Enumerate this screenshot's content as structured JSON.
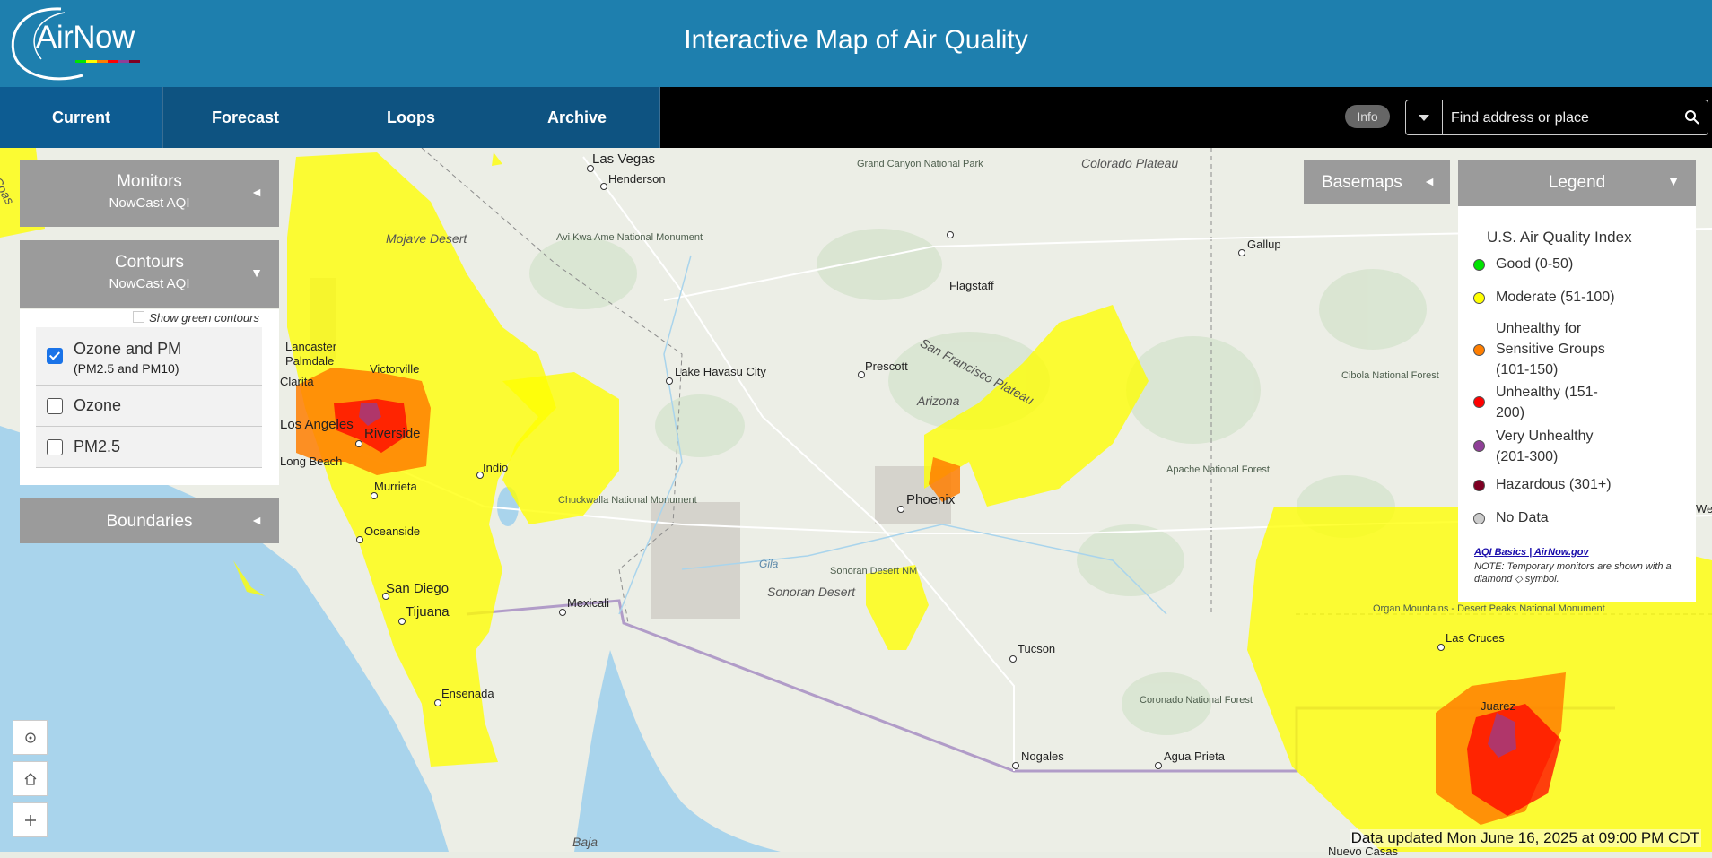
{
  "header": {
    "logo_text": "AirNow",
    "title": "Interactive Map of Air Quality"
  },
  "nav": {
    "tabs": [
      {
        "label": "Current",
        "active": true
      },
      {
        "label": "Forecast",
        "active": false
      },
      {
        "label": "Loops",
        "active": false
      },
      {
        "label": "Archive",
        "active": false
      }
    ],
    "info_label": "Info",
    "search_placeholder": "Find address or place"
  },
  "panels": {
    "monitors": {
      "title": "Monitors",
      "subtitle": "NowCast AQI",
      "arrow": "◄"
    },
    "contours": {
      "title": "Contours",
      "subtitle": "NowCast AQI",
      "arrow": "▼",
      "show_green_label": "Show green contours",
      "show_green_checked": false,
      "options": [
        {
          "label": "Ozone and PM",
          "sub": "(PM2.5 and PM10)",
          "checked": true
        },
        {
          "label": "Ozone",
          "sub": "",
          "checked": false
        },
        {
          "label": "PM2.5",
          "sub": "",
          "checked": false
        }
      ]
    },
    "boundaries": {
      "title": "Boundaries",
      "arrow": "◄"
    },
    "basemaps": {
      "title": "Basemaps",
      "arrow": "◄"
    },
    "legend": {
      "title": "Legend",
      "arrow": "▼",
      "heading": "U.S. Air Quality Index",
      "items": [
        {
          "label": "Good (0-50)",
          "color": "#00e400"
        },
        {
          "label": "Moderate (51-100)",
          "color": "#ffff00"
        },
        {
          "label": "Unhealthy for Sensitive Groups (101-150)",
          "color": "#ff7e00"
        },
        {
          "label": "Unhealthy (151-200)",
          "color": "#ff0000"
        },
        {
          "label": "Very Unhealthy (201-300)",
          "color": "#8f3f97"
        },
        {
          "label": "Hazardous (301+)",
          "color": "#7e0023"
        },
        {
          "label": "No Data",
          "color": "#cccccc"
        }
      ],
      "link_text": "AQI Basics | AirNow.gov",
      "note": "NOTE: Temporary monitors are shown with a diamond ◇ symbol."
    }
  },
  "map": {
    "places": [
      "Las Vegas",
      "Henderson",
      "Grand Canyon National Park",
      "Colorado Plateau",
      "Gallup",
      "Avi Kwa Ame National Monument",
      "Mojave Desert",
      "Flagstaff",
      "San Francisco Plateau",
      "Lancaster",
      "Palmdale",
      "Victorville",
      "Clarita",
      "Lake Havasu City",
      "Prescott",
      "Los Angeles",
      "Riverside",
      "Long Beach",
      "Arizona",
      "Cibola National Forest",
      "Indio",
      "Murrieta",
      "Chuckwalla National Monument",
      "Phoenix",
      "Apache National Forest",
      "Oceanside",
      "San Diego",
      "Tijuana",
      "Mexicali",
      "Gila",
      "Sonoran Desert NM",
      "Sonoran Desert",
      "Tucson",
      "Organ Mountains - Desert Peaks National Monument",
      "Las Cruces",
      "Ensenada",
      "Coronado National Forest",
      "Juarez",
      "Nogales",
      "Agua Prieta",
      "Baja",
      "Nuevo Casas",
      "Coas",
      "Wes"
    ]
  },
  "footer": {
    "updated_text": "Data updated Mon June 16, 2025 at 09:00 PM CDT"
  }
}
